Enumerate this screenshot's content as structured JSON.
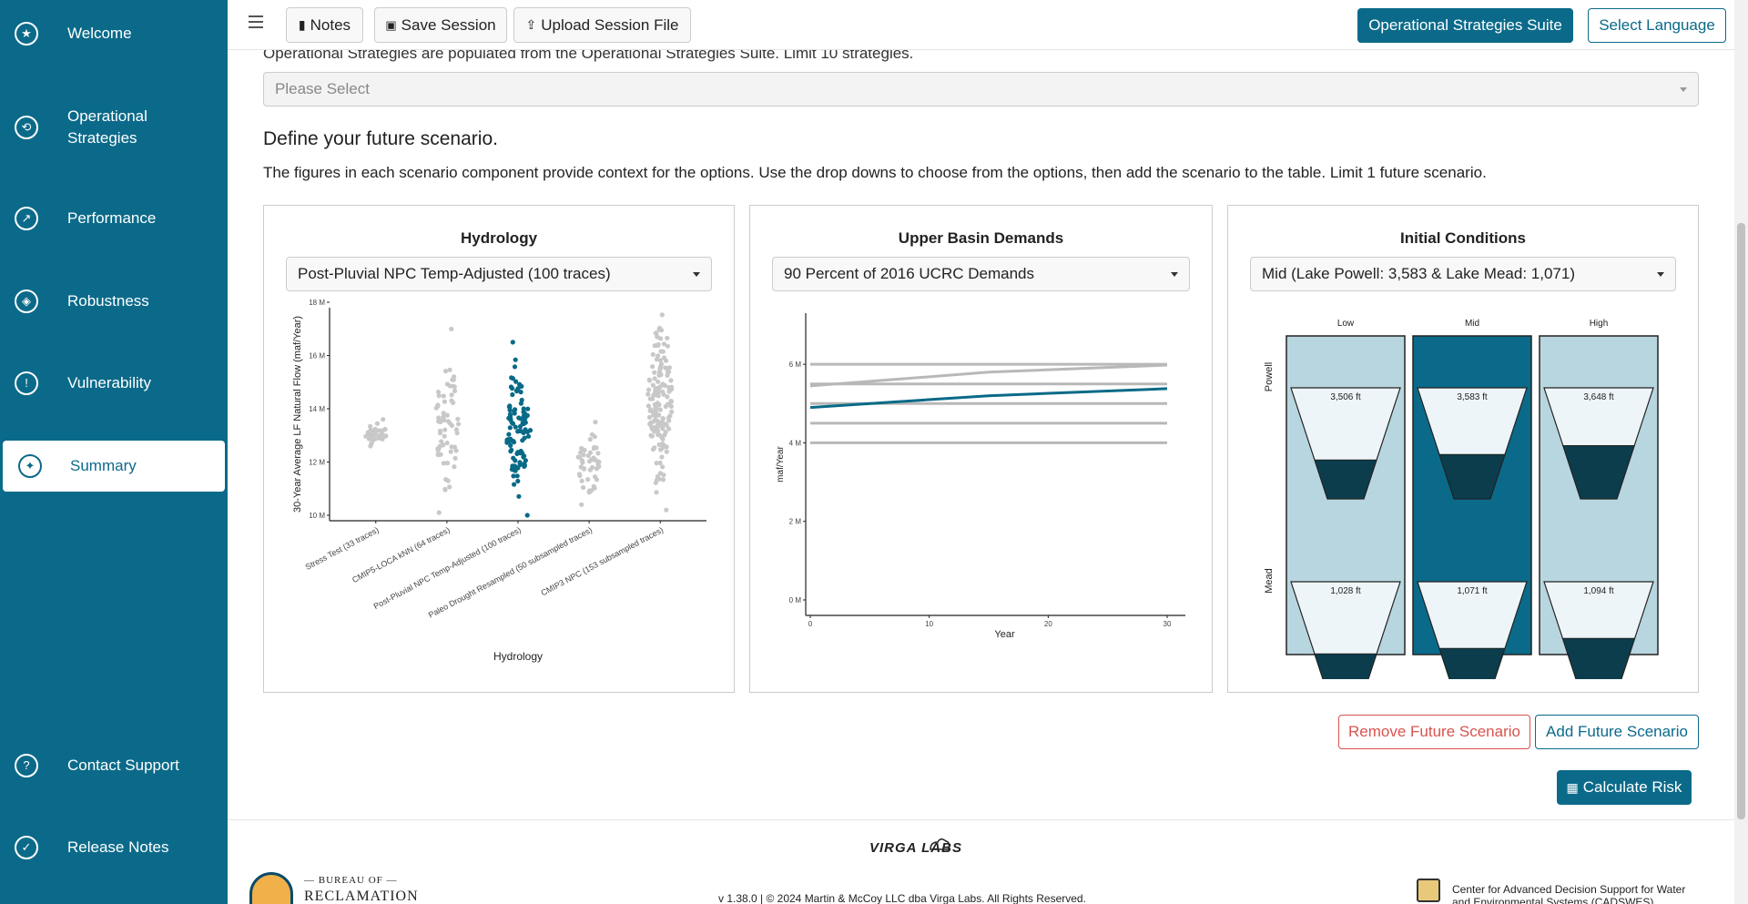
{
  "sidebar": {
    "items": [
      {
        "label": "Welcome",
        "icon": "star-icon"
      },
      {
        "label": "Operational Strategies",
        "icon": "cycle-icon"
      },
      {
        "label": "Performance",
        "icon": "chart-icon"
      },
      {
        "label": "Robustness",
        "icon": "shield-icon"
      },
      {
        "label": "Vulnerability",
        "icon": "warning-icon"
      },
      {
        "label": "Summary",
        "icon": "summary-icon"
      },
      {
        "label": "Contact Support",
        "icon": "support-icon"
      },
      {
        "label": "Release Notes",
        "icon": "notes-icon"
      }
    ],
    "active": "Summary"
  },
  "toolbar": {
    "notes": "Notes",
    "save_session": "Save Session",
    "upload_session": "Upload Session File",
    "suite": "Operational Strategies Suite",
    "language": "Select Language"
  },
  "strategies": {
    "hint": "Operational Strategies are populated from the Operational Strategies Suite. Limit 10 strategies.",
    "placeholder": "Please Select"
  },
  "scenario": {
    "heading": "Define your future scenario.",
    "description": "The figures in each scenario component provide context for the options. Use the drop downs to choose from the options, then add the scenario to the table. Limit 1 future scenario."
  },
  "hydrology": {
    "title": "Hydrology",
    "selected": "Post-Pluvial NPC Temp-Adjusted (100 traces)"
  },
  "demands": {
    "title": "Upper Basin Demands",
    "selected": "90 Percent of 2016 UCRC Demands"
  },
  "initial": {
    "title": "Initial Conditions",
    "selected": "Mid (Lake Powell: 3,583 & Lake Mead: 1,071)"
  },
  "actions": {
    "remove": "Remove Future Scenario",
    "add": "Add Future Scenario",
    "calculate": "Calculate Risk"
  },
  "footer": {
    "version": "v 1.38.0 | © 2024 Martin & McCoy LLC dba Virga Labs. All Rights Reserved.",
    "virga": "VIRGA LABS",
    "reclamation_top": "— BUREAU OF —",
    "reclamation_bottom": "RECLAMATION",
    "cadswes": "Center for Advanced Decision Support for Water and Environmental Systems (CADSWES)"
  },
  "colors": {
    "accent": "#0b6a8a",
    "highlight": "#086a87",
    "muted": "#c8c8c8",
    "reservoir_bg": "#b8d6df",
    "danger": "#d9534f"
  },
  "chart_data": [
    {
      "type": "scatter",
      "title": "",
      "xlabel": "Hydrology",
      "ylabel": "30-Year Average LF Natural Flow (maf/Year)",
      "ylim": [
        10,
        18
      ],
      "yticks": [
        "10 M",
        "12 M",
        "14 M",
        "16 M",
        "18 M"
      ],
      "categories": [
        "Stress Test (33 traces)",
        "CMIP5-LOCA kNN (64 traces)",
        "Post-Pluvial NPC Temp-Adjusted (100 traces)",
        "Paleo Drought Resampled (50 subsampled traces)",
        "CMIP3 NPC (153 subsampled traces)"
      ],
      "ranges": [
        [
          12.6,
          13.6
        ],
        [
          10.1,
          17.0
        ],
        [
          10.0,
          16.5
        ],
        [
          10.4,
          13.5
        ],
        [
          10.2,
          18.5
        ]
      ],
      "counts": [
        33,
        64,
        100,
        50,
        153
      ],
      "highlighted": "Post-Pluvial NPC Temp-Adjusted (100 traces)"
    },
    {
      "type": "line",
      "title": "",
      "xlabel": "Year",
      "ylabel": "maf/Year",
      "xlim": [
        0,
        30
      ],
      "ylim": [
        0,
        7
      ],
      "xticks": [
        "0",
        "10",
        "20",
        "30"
      ],
      "yticks": [
        "0 M",
        "2 M",
        "4 M",
        "6 M"
      ],
      "series": [
        {
          "values": [
            [
              0,
              6.0
            ],
            [
              30,
              6.0
            ]
          ]
        },
        {
          "values": [
            [
              0,
              5.45
            ],
            [
              15,
              5.8
            ],
            [
              30,
              5.98
            ]
          ]
        },
        {
          "values": [
            [
              0,
              5.5
            ],
            [
              30,
              5.5
            ]
          ]
        },
        {
          "values": [
            [
              0,
              5.0
            ],
            [
              30,
              5.0
            ]
          ]
        },
        {
          "values": [
            [
              0,
              4.5
            ],
            [
              30,
              4.5
            ]
          ]
        },
        {
          "values": [
            [
              0,
              4.0
            ],
            [
              30,
              4.0
            ]
          ]
        },
        {
          "values": [
            [
              0,
              4.9
            ],
            [
              15,
              5.2
            ],
            [
              30,
              5.38
            ]
          ],
          "highlight": true
        }
      ]
    },
    {
      "type": "table",
      "columns": [
        "Low",
        "Mid",
        "High"
      ],
      "rows": [
        "Powell",
        "Mead"
      ],
      "powell": [
        "3,506 ft",
        "3,583 ft",
        "3,648 ft"
      ],
      "mead": [
        "1,028 ft",
        "1,071 ft",
        "1,094 ft"
      ],
      "powell_fill": [
        0.35,
        0.4,
        0.48
      ],
      "mead_fill": [
        0.35,
        0.4,
        0.49
      ],
      "selected": "Mid"
    }
  ]
}
